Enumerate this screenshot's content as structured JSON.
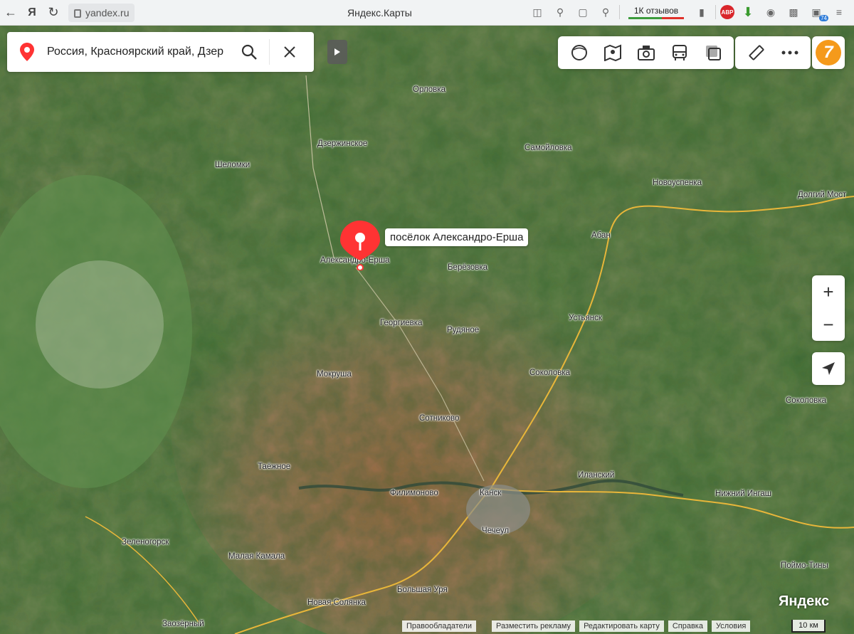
{
  "browser": {
    "url": "yandex.ru",
    "page_title": "Яндекс.Карты",
    "reviews_label": "1К отзывов",
    "abp_label": "ABP",
    "badge_count": "74"
  },
  "search": {
    "value": "Россия, Красноярский край, Дзер"
  },
  "avatar_text": "7",
  "zoom": {
    "in": "+",
    "out": "−"
  },
  "marker_label": "посёлок Александро-Ерша",
  "places": [
    {
      "name": "Орловка"
    },
    {
      "name": "Дзержинское"
    },
    {
      "name": "Самойловка"
    },
    {
      "name": "Шеломки"
    },
    {
      "name": "Новоуспенка"
    },
    {
      "name": "Долгий Мост"
    },
    {
      "name": "Абан"
    },
    {
      "name": "Александро-Ерша"
    },
    {
      "name": "Берёзовка"
    },
    {
      "name": "Георгиевка"
    },
    {
      "name": "Рудяное"
    },
    {
      "name": "Устьянск"
    },
    {
      "name": "Мокруша"
    },
    {
      "name": "Соколовка"
    },
    {
      "name": "Соколовка"
    },
    {
      "name": "Сотниково"
    },
    {
      "name": "Таёжное"
    },
    {
      "name": "Иланский"
    },
    {
      "name": "Филимоново"
    },
    {
      "name": "Канск"
    },
    {
      "name": "Нижний Ингаш"
    },
    {
      "name": "Чечеул"
    },
    {
      "name": "Зеленогорск"
    },
    {
      "name": "Малая Камала"
    },
    {
      "name": "Поймо-Тины"
    },
    {
      "name": "Большая Уря"
    },
    {
      "name": "Новая Солянка"
    },
    {
      "name": "Заозёрный"
    }
  ],
  "logo": "Яндекс",
  "footer": {
    "copyright": "Правообладатели",
    "ads": "Разместить рекламу",
    "edit": "Редактировать карту",
    "help": "Справка",
    "terms": "Условия"
  },
  "scale_label": "10 км"
}
